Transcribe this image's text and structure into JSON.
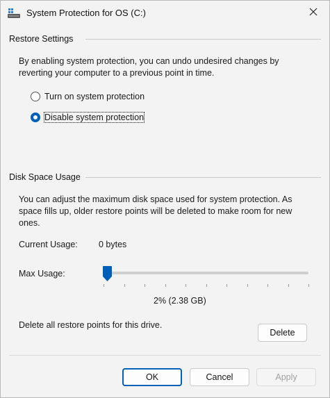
{
  "window": {
    "title": "System Protection for OS (C:)",
    "close_icon": "close-icon",
    "app_icon": "drive-icon"
  },
  "restore_settings": {
    "heading": "Restore Settings",
    "description_line1": "By enabling system protection, you can undo undesired changes by",
    "description_line2": "reverting your computer to a previous point in time.",
    "options": [
      {
        "label": "Turn on system protection",
        "checked": false
      },
      {
        "label": "Disable system protection",
        "checked": true
      }
    ]
  },
  "disk_space": {
    "heading": "Disk Space Usage",
    "description_line1": "You can adjust the maximum disk space used for system protection. As",
    "description_line2": "space fills up, older restore points will be deleted to make room for new",
    "description_line3": "ones.",
    "current_usage_label": "Current Usage:",
    "current_usage_value": "0 bytes",
    "max_usage_label": "Max Usage:",
    "max_usage_fraction": 0.02,
    "max_usage_display": "2% (2.38 GB)",
    "delete_description": "Delete all restore points for this drive.",
    "delete_label": "Delete"
  },
  "footer": {
    "ok_label": "OK",
    "cancel_label": "Cancel",
    "apply_label": "Apply"
  },
  "colors": {
    "accent": "#005fb8",
    "window_bg": "#f3f3f3"
  }
}
